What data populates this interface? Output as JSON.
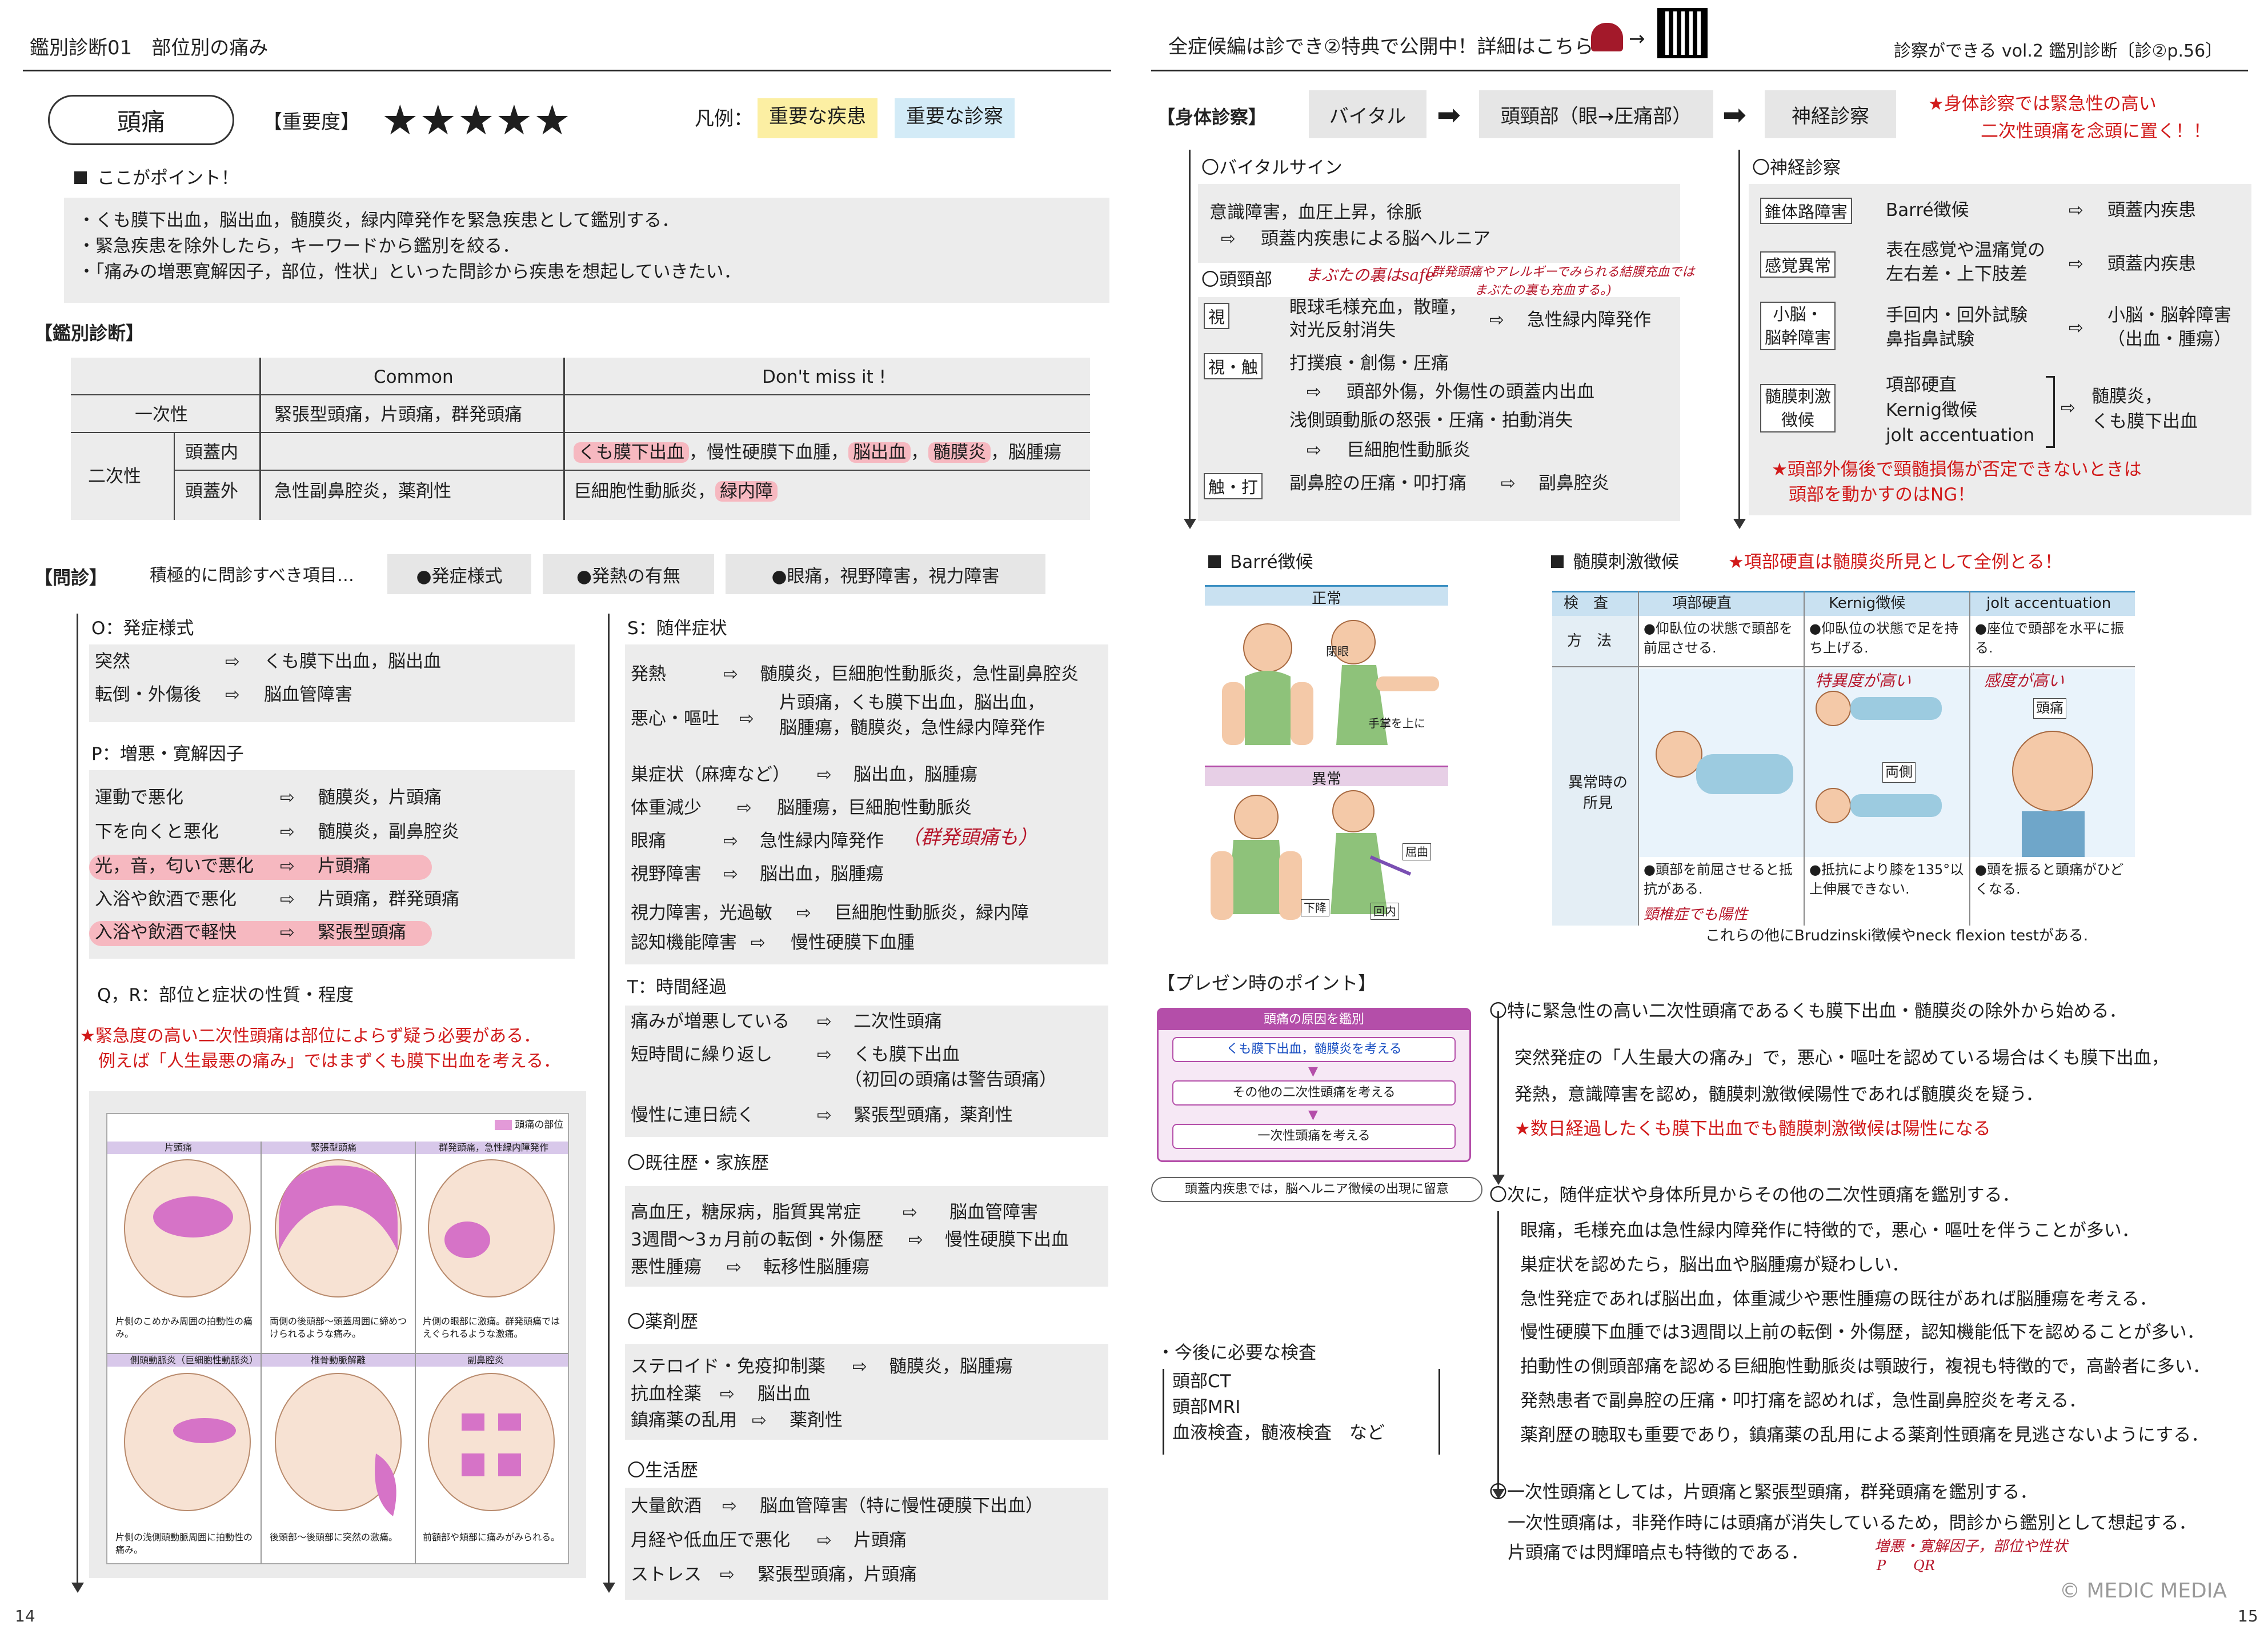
{
  "left": {
    "header": "鑑別診断01　部位別の痛み",
    "title": "頭痛",
    "importance_label": "【重要度】",
    "importance_stars": "★★★★★",
    "legend_label": "凡例：",
    "legend_disease": "重要な疾患",
    "legend_exam": "重要な診察",
    "point_label": "ここがポイント！",
    "points": [
      "・くも膜下出血，脳出血，髄膜炎，緑内障発作を緊急疾患として鑑別する．",
      "・緊急疾患を除外したら，キーワードから鑑別を絞る．",
      "・「痛みの増悪寛解因子，部位，性状」といった問診から疾患を想起していきたい．"
    ],
    "ddx_label": "【鑑別診断】",
    "ddx_table": {
      "col_common": "Common",
      "col_dontmiss": "Don't miss it !",
      "primary": "一次性",
      "primary_common": "緊張型頭痛，片頭痛，群発頭痛",
      "secondary": "二次性",
      "intra": "頭蓋内",
      "intra_dm": [
        "くも膜下出血",
        "，慢性硬膜下血腫，",
        "脳出血",
        "，",
        "髄膜炎",
        "，脳腫瘍"
      ],
      "extra": "頭蓋外",
      "extra_common": "急性副鼻腔炎，薬剤性",
      "extra_dm": [
        "巨細胞性動脈炎，",
        "緑内障"
      ]
    },
    "interview_label": "【問診】",
    "interview_note": "積極的に問診すべき項目…",
    "interview_pills": [
      "●発症様式",
      "●発熱の有無",
      "●眼痛，視野障害，視力障害"
    ],
    "o_title": "O：発症様式",
    "o_rows": [
      {
        "k": "突然",
        "v": "くも膜下出血，脳出血"
      },
      {
        "k": "転倒・外傷後",
        "v": "脳血管障害"
      }
    ],
    "p_title": "P：増悪・寛解因子",
    "p_rows": [
      {
        "k": "運動で悪化",
        "v": "髄膜炎，片頭痛"
      },
      {
        "k": "下を向くと悪化",
        "v": "髄膜炎，副鼻腔炎"
      },
      {
        "k": "光，音，匂いで悪化",
        "v": "片頭痛"
      },
      {
        "k": "入浴や飲酒で悪化",
        "v": "片頭痛，群発頭痛"
      },
      {
        "k": "入浴や飲酒で軽快",
        "v": "緊張型頭痛"
      }
    ],
    "qr_title": "Q，R：部位と症状の性質・程度",
    "qr_note1": "★緊急度の高い二次性頭痛は部位によらず疑う必要がある．",
    "qr_note2": "例えば「人生最悪の痛み」ではまずくも膜下出血を考える．",
    "fig_legend": "頭痛の部位",
    "fig_heads": [
      "片頭痛",
      "緊張型頭痛",
      "群発頭痛，急性緑内障発作",
      "側頭動脈炎（巨細胞性動脈炎）",
      "椎骨動脈解離",
      "副鼻腔炎"
    ],
    "fig_caps": [
      "片側のこめかみ周囲の拍動性の痛み。",
      "両側の後頭部〜頭蓋周囲に締めつけられるような痛み。",
      "片側の眼部に激痛。群発頭痛ではえぐられるような激痛。",
      "片側の浅側頭動脈周囲に拍動性の痛み。",
      "後頭部〜後頭部に突然の激痛。",
      "前額部や頬部に痛みがみられる。"
    ],
    "s_title": "S：随伴症状",
    "s_rows": [
      {
        "k": "発熱",
        "v": "髄膜炎，巨細胞性動脈炎，急性副鼻腔炎"
      },
      {
        "k": "悪心・嘔吐",
        "v": "片頭痛，くも膜下出血，脳出血，",
        "v2": "脳腫瘍，髄膜炎，急性緑内障発作"
      },
      {
        "k": "巣症状（麻痺など）",
        "v": "脳出血，脳腫瘍"
      },
      {
        "k": "体重減少",
        "v": "脳腫瘍，巨細胞性動脈炎"
      },
      {
        "k": "眼痛",
        "v": "急性緑内障発作"
      },
      {
        "k": "視野障害",
        "v": "脳出血，脳腫瘍"
      },
      {
        "k": "視力障害，光過敏",
        "v": "巨細胞性動脈炎，緑内障"
      },
      {
        "k": "認知機能障害",
        "v": "慢性硬膜下血腫"
      }
    ],
    "s_hand": "（群発頭痛も）",
    "t_title": "T：時間経過",
    "t_rows": [
      {
        "k": "痛みが増悪している",
        "v": "二次性頭痛"
      },
      {
        "k": "短時間に繰り返し",
        "v": "くも膜下出血",
        "v2": "（初回の頭痛は警告頭痛）"
      },
      {
        "k": "慢性に連日続く",
        "v": "緊張型頭痛，薬剤性"
      }
    ],
    "hx_title": "〇既往歴・家族歴",
    "hx_rows": [
      {
        "k": "高血圧，糖尿病，脂質異常症",
        "v": "脳血管障害"
      },
      {
        "k": "3週間〜3ヵ月前の転倒・外傷歴",
        "v": "慢性硬膜下出血"
      },
      {
        "k": "悪性腫瘍",
        "v": "転移性脳腫瘍"
      }
    ],
    "drug_title": "〇薬剤歴",
    "drug_rows": [
      {
        "k": "ステロイド・免疫抑制薬",
        "v": "髄膜炎，脳腫瘍"
      },
      {
        "k": "抗血栓薬",
        "v": "脳出血"
      },
      {
        "k": "鎮痛薬の乱用",
        "v": "薬剤性"
      }
    ],
    "life_title": "〇生活歴",
    "life_rows": [
      {
        "k": "大量飲酒",
        "v": "脳血管障害（特に慢性硬膜下出血）"
      },
      {
        "k": "月経や低血圧で悪化",
        "v": "片頭痛"
      },
      {
        "k": "ストレス",
        "v": "緊張型頭痛，片頭痛"
      }
    ],
    "page_no": "14"
  },
  "right": {
    "header_left": "全症候編は診でき②特典で公開中！詳細はこちら",
    "header_right": "診察ができる vol.2 鑑別診断〔診②p.56〕",
    "pe_label": "【身体診察】",
    "pe_flow": [
      "バイタル",
      "頭頸部（眼→圧痛部）",
      "神経診察"
    ],
    "pe_note1": "★身体診察では緊急性の高い",
    "pe_note2": "二次性頭痛を念頭に置く！！",
    "vital_title": "〇バイタルサイン",
    "vital_l1": "意識障害，血圧上昇，徐脈",
    "vital_l2": "頭蓋内疾患による脳ヘルニア",
    "hn_title": "〇頭頸部",
    "hn_hand1": "まぶたの裏はsafe",
    "hn_hand2": "(群発頭痛やアレルギーでみられる結膜充血では",
    "hn_hand3": "まぶたの裏も充血する。)",
    "hn_tag1": "視",
    "hn_l1": "眼球毛様充血，散瞳，",
    "hn_l1b": "対光反射消失",
    "hn_r1": "急性緑内障発作",
    "hn_tag2": "視・触",
    "hn_l2": "打撲痕・創傷・圧痛",
    "hn_r2": "頭部外傷，外傷性の頭蓋内出血",
    "hn_l3": "浅側頭動脈の怒張・圧痛・拍動消失",
    "hn_r3": "巨細胞性動脈炎",
    "hn_tag3": "触・打",
    "hn_l4": "副鼻腔の圧痛・叩打痛",
    "hn_r4": "副鼻腔炎",
    "neuro_title": "〇神経診察",
    "neuro_rows": [
      {
        "tag": "錐体路障害",
        "k": "Barré徴候",
        "v": "頭蓋内疾患"
      },
      {
        "tag": "感覚異常",
        "k": "表在感覚や温痛覚の",
        "k2": "左右差・上下肢差",
        "v": "頭蓋内疾患"
      },
      {
        "tag": "小脳・",
        "tag2": "脳幹障害",
        "k": "手回内・回外試験",
        "k2": "鼻指鼻試験",
        "v": "小脳・脳幹障害",
        "v2": "（出血・腫瘍）"
      },
      {
        "tag": "髄膜刺激",
        "tag2": "徴候",
        "k": "項部硬直",
        "k2": "Kernig徴候",
        "k3": "jolt accentuation",
        "v": "髄膜炎，",
        "v2": "くも膜下出血"
      }
    ],
    "neuro_note1": "★頭部外傷後で頸髄損傷が否定できないときは",
    "neuro_note2": "頭部を動かすのはNG！",
    "barre_title": "Barré徴候",
    "barre_normal": "正常",
    "barre_abnormal": "異常",
    "barre_labels": [
      "閉眼",
      "手掌を上に",
      "屈曲",
      "下降",
      "回内"
    ],
    "mening_title": "髄膜刺激徴候",
    "mening_note": "★項部硬直は髄膜炎所見として全例とる！",
    "mening_table": {
      "h0": "検　査",
      "h1": "項部硬直",
      "h2": "Kernig徴候",
      "h3": "jolt accentuation",
      "method": "方　法",
      "m1": "●仰臥位の状態で頭部を前屈させる.",
      "m2": "●仰臥位の状態で足を持ち上げる.",
      "m3": "●座位で頭部を水平に振る.",
      "abn": "異常時の所見",
      "a1": "●頭部を前屈させると抵抗がある.",
      "a2": "●抵抗により膝を135°以上伸展できない.",
      "a3": "●頭を振ると頭痛がひどくなる."
    },
    "mening_hand": [
      "特異度が高い",
      "感度が高い",
      "頸椎症でも陽性"
    ],
    "mening_fig_labels": [
      "両側",
      "頭痛"
    ],
    "mening_foot": "これらの他にBrudzinski徴候やneck flexion testがある.",
    "presen_label": "【プレゼン時のポイント】",
    "presen_fig_title": "頭痛の原因を鑑別",
    "presen_fig_steps": [
      "くも膜下出血，髄膜炎を考える",
      "その他の二次性頭痛を考える",
      "一次性頭痛を考える"
    ],
    "presen_fig_foot": "頭蓋内疾患では，脳ヘルニア徴候の出現に留意",
    "tests_label": "・今後に必要な検査",
    "tests": [
      "頭部CT",
      "頭部MRI",
      "血液検査，髄液検査　など"
    ],
    "pp1": "〇特に緊急性の高い二次性頭痛であるくも膜下出血・髄膜炎の除外から始める．",
    "pp1a": "突然発症の「人生最大の痛み」で，悪心・嘔吐を認めている場合はくも膜下出血，",
    "pp1b": "発熱，意識障害を認め，髄膜刺激徴候陽性であれば髄膜炎を疑う．",
    "pp1c": "★数日経過したくも膜下出血でも髄膜刺激徴候は陽性になる",
    "pp2": "〇次に，随伴症状や身体所見からその他の二次性頭痛を鑑別する．",
    "pp2_lines": [
      "眼痛，毛様充血は急性緑内障発作に特徴的で，悪心・嘔吐を伴うことが多い．",
      "巣症状を認めたら，脳出血や脳腫瘍が疑わしい．",
      "急性発症であれば脳出血，体重減少や悪性腫瘍の既往があれば脳腫瘍を考える．",
      "慢性硬膜下血腫では3週間以上前の転倒・外傷歴，認知機能低下を認めることが多い．",
      "拍動性の側頭部痛を認める巨細胞性動脈炎は顎跛行，複視も特徴的で，高齢者に多い．",
      "発熱患者で副鼻腔の圧痛・叩打痛を認めれば，急性副鼻腔炎を考える．",
      "薬剤歴の聴取も重要であり，鎮痛薬の乱用による薬剤性頭痛を見逃さないようにする．"
    ],
    "pp3": "〇一次性頭痛としては，片頭痛と緊張型頭痛，群発頭痛を鑑別する．",
    "pp3a": "一次性頭痛は，非発作時には頭痛が消失しているため，問診から鑑別として想起する．",
    "pp3b": "片頭痛では閃輝暗点も特徴的である．",
    "pp3_hand": "増悪・寛解因子，部位や性状",
    "pp3_hand2": "P　　QR",
    "copyright": "© MEDIC MEDIA",
    "page_no": "15"
  },
  "colors": {
    "pink": "#f6b8c0",
    "yellow": "#fcefa3",
    "blue": "#d3ebf7",
    "red": "#d11a1a",
    "gray": "#ececec"
  }
}
